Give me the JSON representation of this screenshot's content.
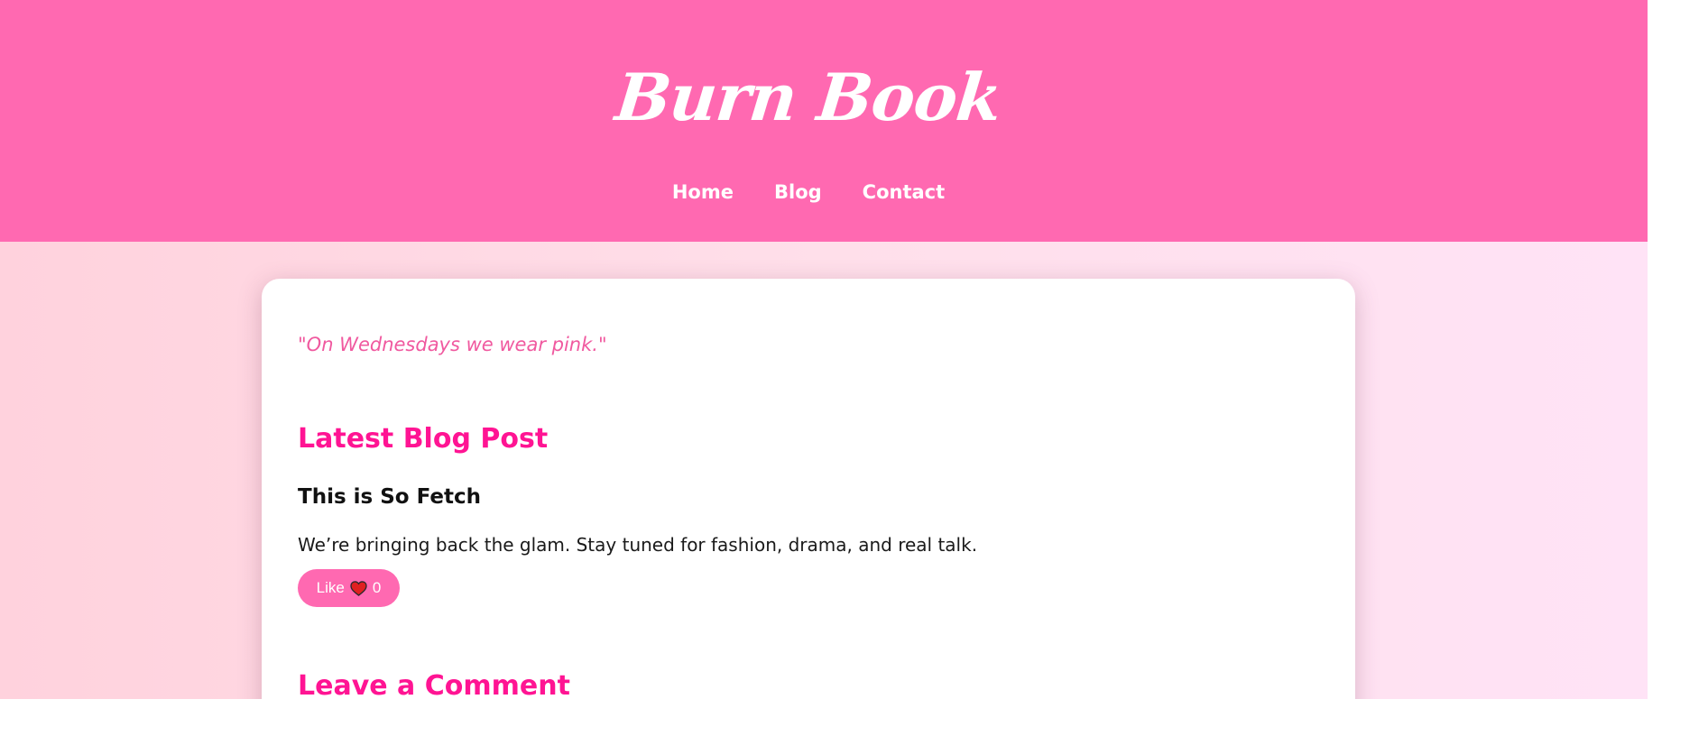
{
  "site": {
    "title": "Burn Book"
  },
  "nav": {
    "items": [
      {
        "label": "Home"
      },
      {
        "label": "Blog"
      },
      {
        "label": "Contact"
      }
    ]
  },
  "main": {
    "quote": "\"On Wednesdays we wear pink.\"",
    "latest_heading": "Latest Blog Post",
    "post": {
      "title": "This is So Fetch",
      "body": "We’re bringing back the glam. Stay tuned for fashion, drama, and real talk."
    },
    "like": {
      "label": "Like",
      "icon": "heart-icon",
      "count": "0"
    },
    "comment_heading": "Leave a Comment"
  },
  "colors": {
    "header": "#ff69b1",
    "accent": "#ff1493",
    "quote": "#f0599f",
    "heart": "#e02020"
  }
}
